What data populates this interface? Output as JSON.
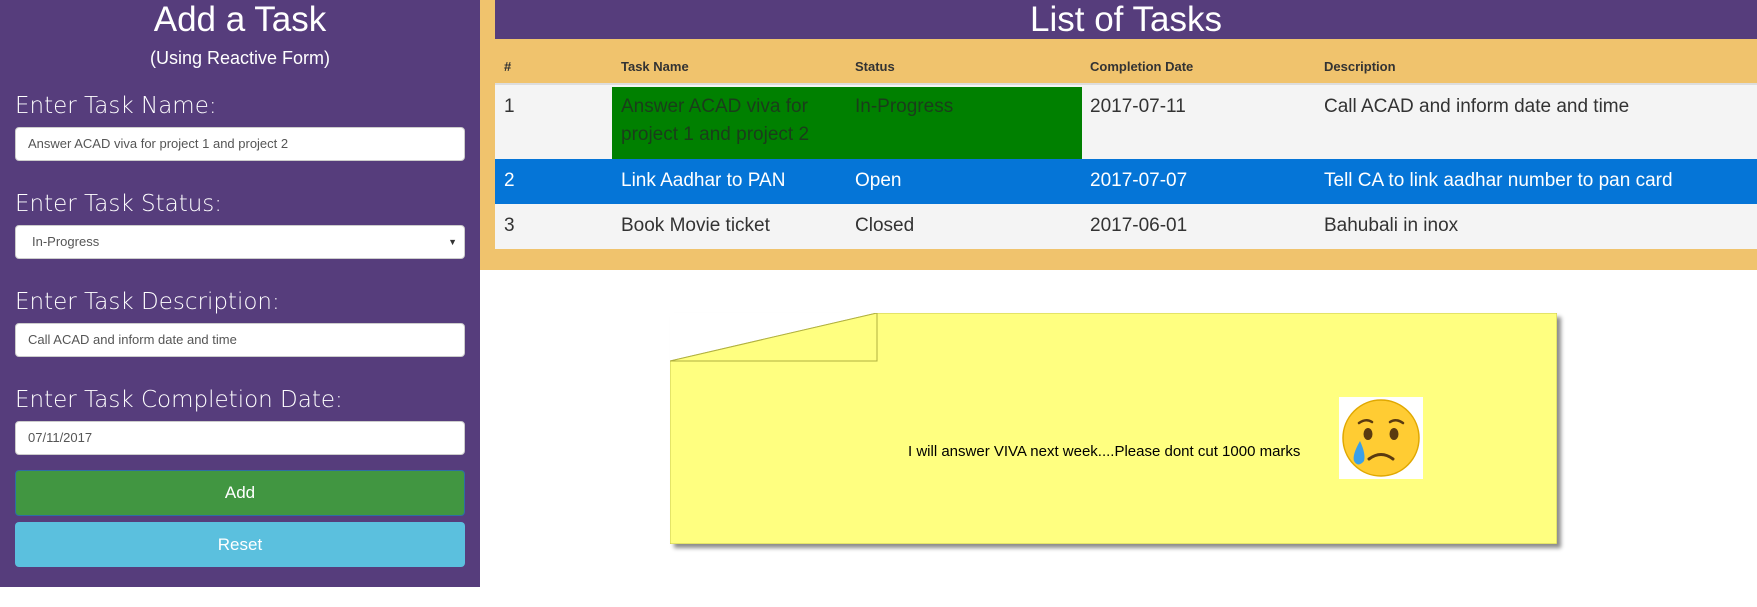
{
  "form": {
    "title": "Add a Task",
    "subtitle": "(Using Reactive Form)",
    "name_label": "Enter Task Name:",
    "name_value": "Answer ACAD viva for project 1 and project 2",
    "status_label": "Enter Task Status:",
    "status_value": "In-Progress",
    "description_label": "Enter Task Description:",
    "description_value": "Call ACAD and inform date and time",
    "date_label": "Enter Task Completion Date:",
    "date_value": "07/11/2017",
    "add_label": "Add",
    "reset_label": "Reset"
  },
  "list": {
    "title": "List of Tasks",
    "headers": [
      "#",
      "Task Name",
      "Status",
      "Completion Date",
      "Description"
    ],
    "rows": [
      {
        "num": "1",
        "name_line1": "Answer ACAD viva for",
        "name_line2": "project 1 and project 2",
        "status": "In-Progress",
        "date": "2017-07-11",
        "description": "Call ACAD and inform date and time"
      },
      {
        "num": "2",
        "name": "Link Aadhar to PAN",
        "status": "Open",
        "date": "2017-07-07",
        "description": "Tell CA to link aadhar number to pan card"
      },
      {
        "num": "3",
        "name": "Book Movie ticket",
        "status": "Closed",
        "date": "2017-06-01",
        "description": "Bahubali in inox"
      }
    ]
  },
  "note": {
    "text": "I will answer VIVA next week....Please dont cut 1000 marks",
    "emoji_icon": "crying-face-icon"
  },
  "colors": {
    "panel_purple": "#563d7c",
    "table_bg": "#f0c36d",
    "add_green": "#419641",
    "reset_blue": "#5bc0de",
    "highlight_blue": "#0575d7",
    "in_progress_green": "#008000",
    "note_yellow": "#ffff80"
  }
}
